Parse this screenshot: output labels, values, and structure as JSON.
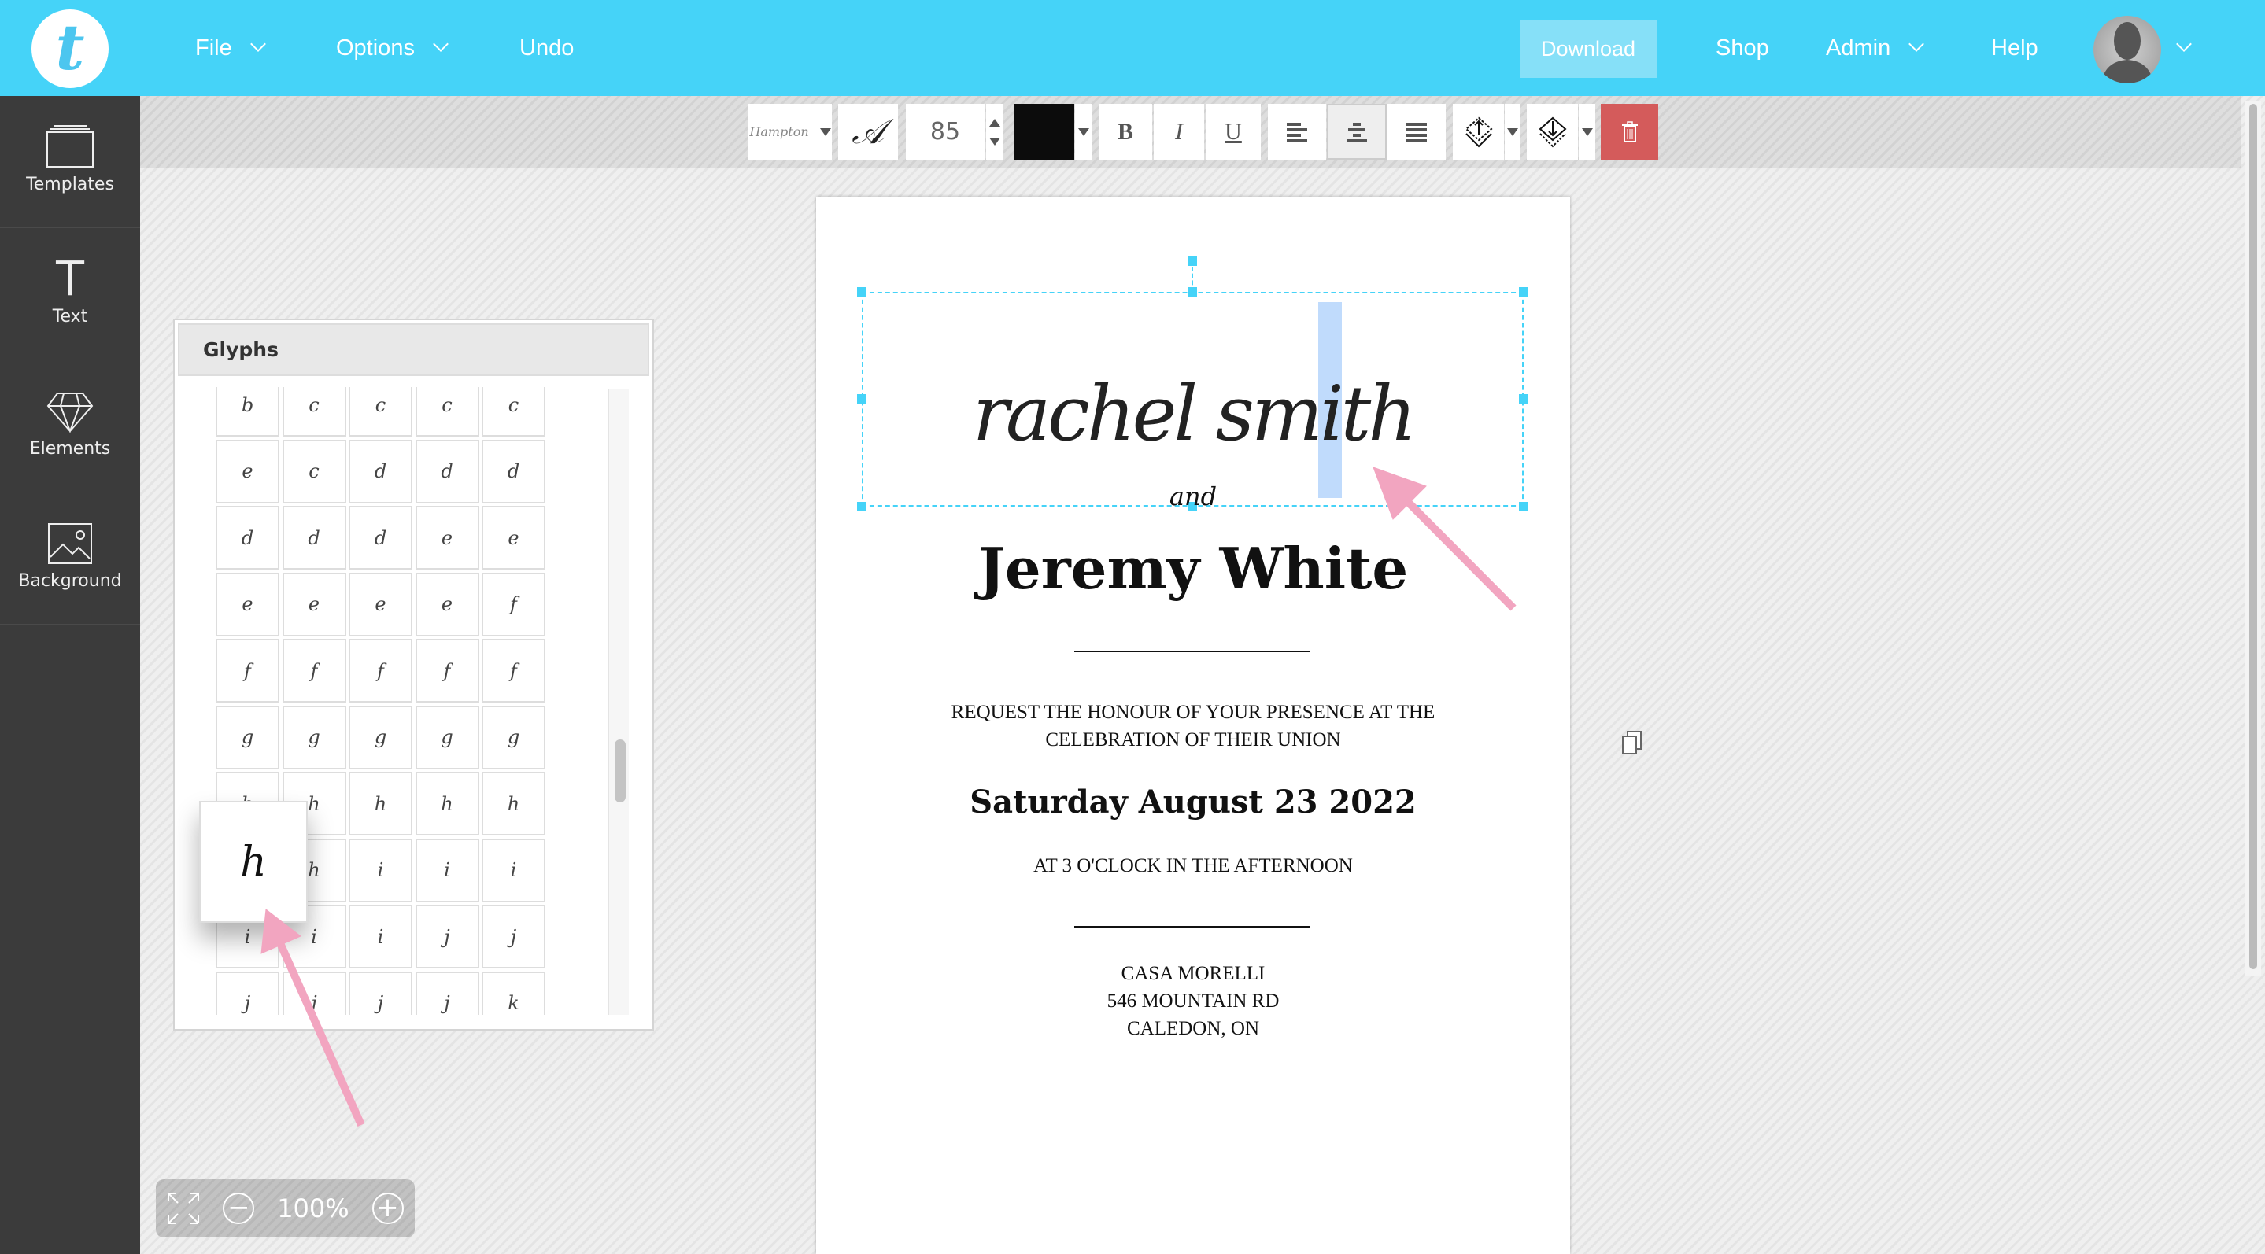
{
  "header": {
    "logo_letter": "t",
    "menu": [
      {
        "label": "File"
      },
      {
        "label": "Options"
      },
      {
        "label": "Undo"
      }
    ],
    "download": "Download",
    "shop": "Shop",
    "admin": "Admin",
    "help": "Help",
    "accent": "#45d3f8"
  },
  "sidebar": {
    "items": [
      {
        "label": "Templates",
        "icon": "templates-icon"
      },
      {
        "label": "Text",
        "icon": "text-icon"
      },
      {
        "label": "Elements",
        "icon": "diamond-icon"
      },
      {
        "label": "Background",
        "icon": "image-icon"
      }
    ]
  },
  "toolbar": {
    "font_name": "Hampton",
    "font_size": "85",
    "color": "#0c0c0c",
    "bold": "B",
    "italic": "I",
    "underline": "U",
    "alignment": "center",
    "delete_color": "#d45b5b"
  },
  "document": {
    "script_text": "rachel smith",
    "and_text": "and",
    "name2": "Jeremy White",
    "request": "REQUEST THE HONOUR OF YOUR PRESENCE AT THE",
    "request2": "CELEBRATION OF THEIR UNION",
    "date": "Saturday August 23 2022",
    "time": "AT 3 O'CLOCK IN THE AFTERNOON",
    "venue": "CASA MORELLI",
    "address": "546 MOUNTAIN RD",
    "city": "CALEDON, ON"
  },
  "glyphs": {
    "title": "Glyphs",
    "preview": "h",
    "rows": [
      [
        "b",
        "c",
        "c",
        "c",
        "c"
      ],
      [
        "e",
        "c",
        "d",
        "d",
        "d"
      ],
      [
        "d",
        "d",
        "d",
        "e",
        "e"
      ],
      [
        "e",
        "e",
        "e",
        "e",
        "f"
      ],
      [
        "f",
        "f",
        "f",
        "f",
        "f"
      ],
      [
        "g",
        "g",
        "g",
        "g",
        "g"
      ],
      [
        "h",
        "h",
        "h",
        "h",
        "h"
      ],
      [
        "h",
        "h",
        "i",
        "i",
        "i"
      ],
      [
        "i",
        "i",
        "i",
        "j",
        "j"
      ],
      [
        "j",
        "j",
        "j",
        "j",
        "k"
      ]
    ]
  },
  "zoom": {
    "level": "100%"
  }
}
